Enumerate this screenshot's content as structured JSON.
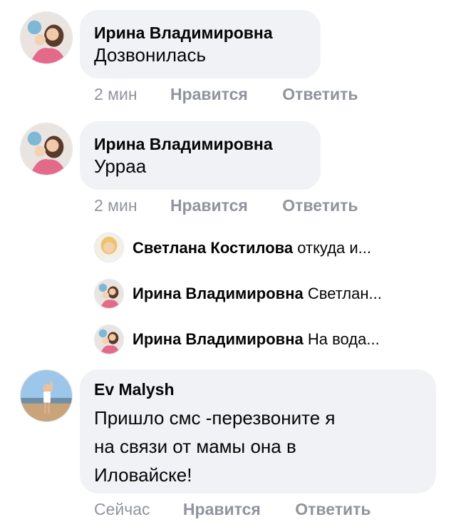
{
  "comments": [
    {
      "author": "Ирина Владимировна",
      "text": "Дозвонилась",
      "time": "2 мин",
      "like_label": "Нравится",
      "reply_label": "Ответить",
      "avatar": "profile-photo-woman-child"
    },
    {
      "author": "Ирина Владимировна",
      "text": "Урраа",
      "time": "2 мин",
      "like_label": "Нравится",
      "reply_label": "Ответить",
      "avatar": "profile-photo-woman-child"
    },
    {
      "author": "Ev Malysh",
      "text_lines": [
        "Пришло смс -перезвоните я",
        "на связи от мамы она в",
        "Иловайске!"
      ],
      "time": "Сейчас",
      "like_label": "Нравится",
      "reply_label": "Ответить",
      "avatar": "profile-photo-person-outdoors"
    }
  ],
  "replies": [
    {
      "author": "Светлана Костилова",
      "preview": "откуда и...",
      "avatar": "profile-photo-blonde-woman"
    },
    {
      "author": "Ирина Владимировна",
      "preview": "Светлан...",
      "avatar": "profile-photo-woman-child"
    },
    {
      "author": "Ирина Владимировна",
      "preview": "На вода...",
      "avatar": "profile-photo-woman-child"
    }
  ],
  "colors": {
    "bubble": "#f0f2f5",
    "meta_text": "#90949c",
    "text": "#050505"
  }
}
